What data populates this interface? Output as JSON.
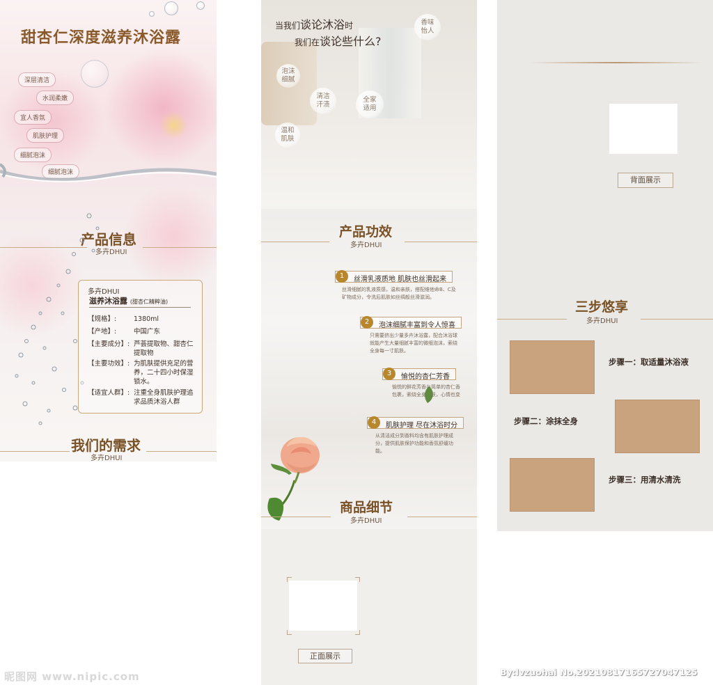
{
  "panel1": {
    "title": "甜杏仁深度滋养沐浴露",
    "tags": [
      "深层清洁",
      "水润柔嫩",
      "宜人香氛",
      "肌肤护理",
      "细腻泡沫",
      "细腻泡沫"
    ],
    "section_info": {
      "title": "产品信息",
      "sub": "多卉DHUI"
    },
    "info": {
      "brand": "多卉DHUI",
      "name": "滋养沐浴露",
      "name_note": "(甜杏仁精粹油)",
      "rows": [
        {
          "k": "【规格】:",
          "v": "1380ml"
        },
        {
          "k": "【产地】:",
          "v": "中国广东"
        },
        {
          "k": "【主要成分】:",
          "v": "芦荟提取物、甜杏仁提取物"
        },
        {
          "k": "【主要功效】:",
          "v": "为肌肤提供充足的营养，二十四小时保湿锁水。"
        },
        {
          "k": "【适宜人群】:",
          "v": "注重全身肌肤护理追求品质沐浴人群"
        }
      ]
    },
    "section_need": {
      "title": "我们的需求",
      "sub": "多卉DHUI"
    }
  },
  "panel2": {
    "q_line1_small": "当我们",
    "q_line1_big": "谈论沐浴",
    "q_line1_end": "时",
    "q_line2_small": "我们在",
    "q_line2_big": "谈论些什么?",
    "bubbles": [
      "香味\n怡人",
      "泡沫\n细腻",
      "清洁\n汗渍",
      "全家\n适用",
      "温和\n肌肤"
    ],
    "section_effect": {
      "title": "产品功效",
      "sub": "多卉DHUI"
    },
    "features": [
      {
        "num": "1",
        "label": "丝滑乳液质地 肌肤也丝滑起来",
        "desc": "丝滑细腻的乳液质感，温和亲肤，搭配维他命B、C及矿物成分，令洗后肌肤如丝绸般丝滑滋润。"
      },
      {
        "num": "2",
        "label": "泡沫细腻丰富到令人惊喜",
        "desc": "只需要挤出少量多卉沐浴露，配合沐浴球就能产生大量细腻丰富的微细泡沫，萦绕全身每一寸肌肤。"
      },
      {
        "num": "3",
        "label": "愉悦的杏仁芳香",
        "desc": "愉悦的鲜花芳香与简单的杏仁香包裹，萦绕全身肌肤，心情也变"
      },
      {
        "num": "4",
        "label": "肌肤护理 尽在沐浴时分",
        "desc": "从清洁成分到香料均含有肌肤护理成分，提供肌肤保护功能和香氛舒缓功能。"
      }
    ],
    "section_detail": {
      "title": "商品细节",
      "sub": "多卉DHUI"
    },
    "front_label": "正面展示"
  },
  "panel3": {
    "back_label": "背面展示",
    "section_steps": {
      "title": "三步悠享",
      "sub": "多卉DHUI"
    },
    "steps": [
      "步骤一：取适量沐浴液",
      "步骤二：涂抹全身",
      "步骤三：用清水清洗"
    ],
    "colors": {
      "step_box": "#c8a37e",
      "accent": "#b8872d"
    }
  },
  "footer": {
    "watermark_left": "昵图网 www.nipic.com",
    "watermark_right": "By:lvzuohai No.20210817165727047125"
  }
}
